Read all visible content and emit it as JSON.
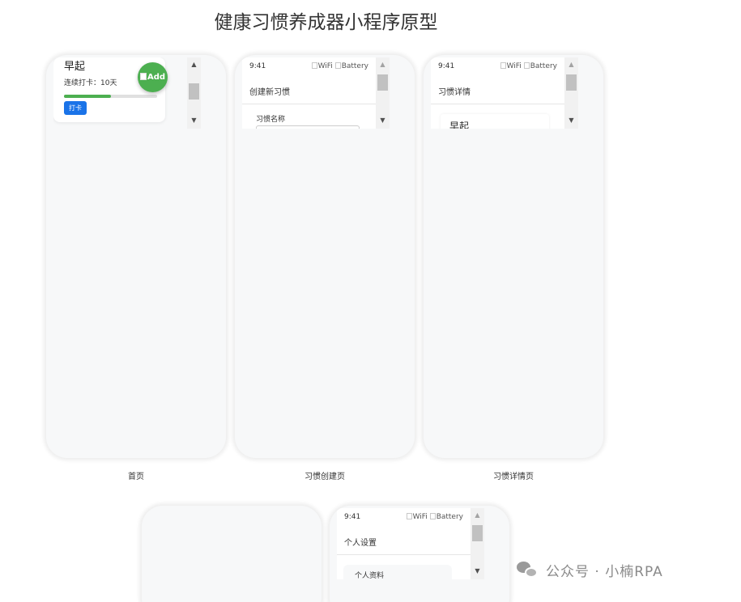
{
  "page": {
    "title": "健康习惯养成器小程序原型"
  },
  "home": {
    "caption": "首页",
    "habit_name": "早起",
    "streak_text": "连续打卡：10天",
    "progress_fraction": 0.5,
    "checkin_label": "打卡",
    "fab_label": "Add"
  },
  "create": {
    "caption": "习惯创建页",
    "time": "9:41",
    "wifi_alt": "WiFi",
    "battery_alt": "Battery",
    "nav_title": "创建新习惯",
    "field_label": "习惯名称",
    "field_value": ""
  },
  "detail": {
    "caption": "习惯详情页",
    "time": "9:41",
    "wifi_alt": "WiFi",
    "battery_alt": "Battery",
    "nav_title": "习惯详情",
    "habit_name": "早起"
  },
  "settings": {
    "time": "9:41",
    "wifi_alt": "WiFi",
    "battery_alt": "Battery",
    "nav_title": "个人设置",
    "section_label": "个人资料"
  },
  "watermark": {
    "text": "公众号 · 小楠RPA"
  },
  "icons": {
    "scroll_up": "up-arrow-icon",
    "scroll_down": "down-arrow-icon",
    "fab": "add-icon"
  },
  "colors": {
    "primary": "#1a73e8",
    "success": "#4caf50",
    "phone_bg": "#f7f8f9"
  }
}
